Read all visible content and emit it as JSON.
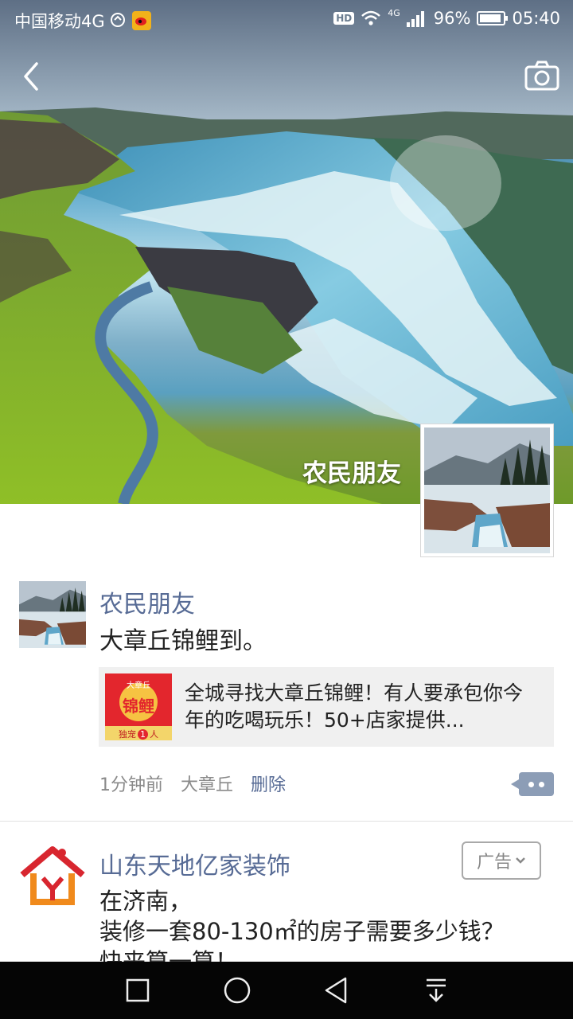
{
  "status_bar": {
    "carrier": "中国移动4G",
    "hd": "HD",
    "network": "4G",
    "battery": "96%",
    "time": "05:40"
  },
  "cover": {
    "name": "农民朋友"
  },
  "posts": [
    {
      "name": "农民朋友",
      "text": "大章丘锦鲤到。",
      "link": {
        "title": "全城寻找大章丘锦鲤！有人要承包你今年的吃喝玩乐！50+店家提供...",
        "thumb_top": "大章丘",
        "thumb_main": "锦鲤",
        "thumb_bottom": "独宠",
        "thumb_num": "1",
        "thumb_unit": "人"
      },
      "time": "1分钟前",
      "location": "大章丘",
      "delete_label": "删除"
    },
    {
      "name": "山东天地亿家装饰",
      "ad_label": "广告",
      "text_lines": [
        "在济南，",
        "装修一套80-130㎡的房子需要多少钱？",
        "快来算一算！"
      ]
    }
  ],
  "colors": {
    "link_blue": "#576b95",
    "nav_bg": "#050505",
    "comment_button": "#8c9db6"
  },
  "icons": [
    "back-arrow-icon",
    "camera-icon",
    "wifi-icon",
    "signal-icon",
    "battery-icon",
    "weibo-icon",
    "square-icon",
    "circle-icon",
    "triangle-back-icon",
    "pull-down-icon"
  ]
}
